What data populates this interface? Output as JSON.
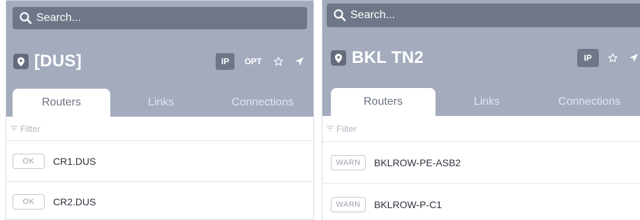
{
  "panels": [
    {
      "search_placeholder": "Search...",
      "location": "[DUS]",
      "actions": {
        "ip": "IP",
        "opt": "OPT"
      },
      "tabs": [
        "Routers",
        "Links",
        "Connections"
      ],
      "filter_placeholder": "Filter",
      "rows": [
        {
          "status": "OK",
          "name": "CR1.DUS"
        },
        {
          "status": "OK",
          "name": "CR2.DUS"
        }
      ]
    },
    {
      "search_placeholder": "Search...",
      "location": "BKL TN2",
      "actions": {
        "ip": "IP"
      },
      "tabs": [
        "Routers",
        "Links",
        "Connections"
      ],
      "filter_placeholder": "Filter",
      "rows": [
        {
          "status": "WARN",
          "name": "BKLROW-PE-ASB2"
        },
        {
          "status": "WARN",
          "name": "BKLROW-P-C1"
        }
      ]
    }
  ],
  "icons": [
    "search-icon",
    "location-pin-icon",
    "star-icon",
    "navigate-arrow-icon",
    "filter-icon"
  ],
  "colors": {
    "header_bg": "#a3abbd",
    "search_bg": "#6e7687",
    "pin_bg": "#646c7c"
  }
}
